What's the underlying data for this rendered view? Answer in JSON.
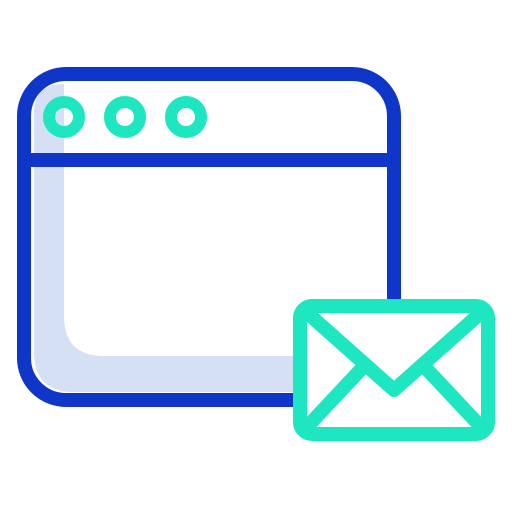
{
  "icon": {
    "name": "browser-window-mail-icon",
    "components": {
      "window": "browser-window-icon",
      "window_dots": [
        "window-dot-icon",
        "window-dot-icon",
        "window-dot-icon"
      ],
      "mail": "mail-envelope-icon"
    }
  },
  "colors": {
    "window_stroke": "#0f35c9",
    "window_shadow": "#d6e0f4",
    "accent": "#1ee6c1",
    "background": "#ffffff"
  }
}
